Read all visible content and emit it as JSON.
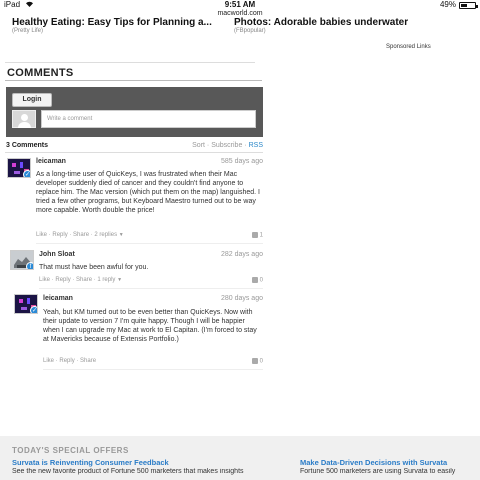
{
  "status_bar": {
    "device": "iPad",
    "wifi_icon": "wifi-icon",
    "time": "9:51 AM",
    "battery": "49%",
    "battery_level": 0.49
  },
  "browser": {
    "url": "macworld.com"
  },
  "top_ads": [
    {
      "headline": "Healthy Eating: Easy Tips for Planning a...",
      "source": "(Pretty Life)"
    },
    {
      "headline": "Photos: Adorable babies underwater",
      "source": "(FBpopular)"
    }
  ],
  "sponsored_label": "Sponsored Links",
  "comments_section": {
    "title": "COMMENTS",
    "login_label": "Login",
    "input_placeholder": "Write a comment",
    "count": "3 Comments",
    "sort": "Sort",
    "subscribe": "Subscribe",
    "rss": "RSS"
  },
  "comments": [
    {
      "author": "leicaman",
      "time": "585 days ago",
      "text": "As a long-time user of QuicKeys, I was frustrated when their Mac developer suddenly died of cancer and they couldn't find anyone to replace him. The Mac version (which put them on the map) languished. I tried a few other programs, but Keyboard Maestro turned out to be way more capable. Worth double the price!",
      "like": "Like",
      "reply": "Reply",
      "share": "Share",
      "replies": "2 replies",
      "votes": "1"
    },
    {
      "author": "John Sloat",
      "time": "282 days ago",
      "text": "That must have been awful for you.",
      "like": "Like",
      "reply": "Reply",
      "share": "Share",
      "replies": "1 reply",
      "votes": "0"
    },
    {
      "author": "leicaman",
      "time": "280 days ago",
      "text": "Yeah, but KM turned out to be even better than QuicKeys. Now with their update to version 7 I'm quite happy. Though I will be happier when I can upgrade my Mac at work to El Capitan. (I'm forced to stay at Mavericks because of Extensis Portfolio.)",
      "like": "Like",
      "reply": "Reply",
      "share": "Share",
      "votes": "0"
    }
  ],
  "offers": {
    "title": "TODAY'S SPECIAL OFFERS",
    "items": [
      {
        "link": "Survata is Reinventing Consumer Feedback",
        "desc": "See the new favorite product of Fortune 500 marketers that makes insights"
      },
      {
        "link": "Make Data-Driven Decisions with Survata",
        "desc": "Fortune 500 marketers are using Survata to easily"
      }
    ]
  },
  "colors": {
    "link_blue": "#2a7cc7",
    "login_box": "#585858",
    "badge_blue": "#2b8ad6"
  }
}
